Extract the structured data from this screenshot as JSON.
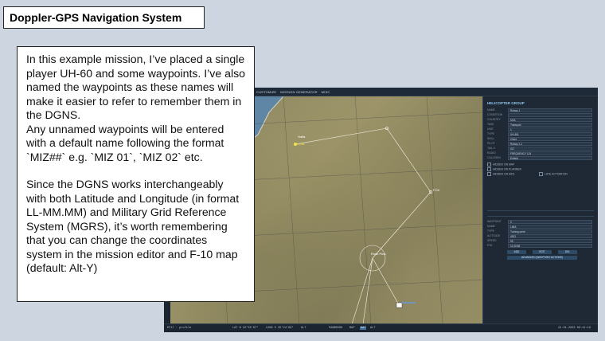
{
  "slide": {
    "title": "Doppler-GPS Navigation System",
    "body_paragraphs": [
      "In this example mission, I’ve placed a single player UH-60 and some waypoints. I’ve also named the waypoints as these names will make it easier to refer to remember them in the DGNS.",
      "Any unnamed waypoints will be entered with a default name following the format `MIZ##` e.g. `MIZ 01`, `MIZ 02` etc.",
      "Since the DGNS works interchangeably with both Latitude and Longitude (in format LL-MM.MM) and Military Grid Reference System (MGRS), it’s worth remembering that you can change the coordinates system in the mission editor and F-10 map (default: Alt-Y)"
    ]
  },
  "editor": {
    "menu": [
      "CUSTOMIZE",
      "MISSION GENERATOR",
      "MISC"
    ],
    "panel_title": "HELICOPTER GROUP",
    "fields": [
      {
        "label": "NAME",
        "value": "Rotary-1"
      },
      {
        "label": "CONDITION",
        "value": ""
      },
      {
        "label": "COUNTRY",
        "value": "USA"
      },
      {
        "label": "TASK",
        "value": "Transport"
      },
      {
        "label": "UNIT",
        "value": "1"
      },
      {
        "label": "TYPE",
        "value": "UH-60L"
      },
      {
        "label": "SKILL",
        "value": "Client"
      },
      {
        "label": "PILOT",
        "value": "Rotary-1-1"
      },
      {
        "label": "TAIL #",
        "value": "017"
      },
      {
        "label": "RADIO",
        "value": "FREQUENCY 124"
      },
      {
        "label": "CALLSIGN",
        "value": "Enfield"
      }
    ],
    "checkboxes": [
      "HIDDEN ON MAP",
      "HIDDEN ON PLANNER",
      "HIDDEN ON MFD",
      "LATE ACTIVATION"
    ],
    "waypoint_fields": [
      {
        "label": "WAYPOINT",
        "value": "0"
      },
      {
        "label": "NAME",
        "value": "LIMA"
      },
      {
        "label": "TYPE",
        "value": "Turning point"
      },
      {
        "label": "ALTITUDE",
        "value": "4922"
      },
      {
        "label": "SPEED",
        "value": "95"
      },
      {
        "label": "ETA",
        "value": "11:40:58"
      }
    ],
    "buttons": [
      "ADD",
      "EDIT",
      "DEL"
    ],
    "advanced_button": "ADVANCED (WAYPOINT ACTIONS)",
    "map_labels": [
      "Haifa",
      "LIMA",
      "FOX",
      "Rosh Pina",
      "Nazareth"
    ],
    "status_bar": {
      "left": "EF17 · profile",
      "lat": "LAT N 32°35'07\"",
      "long": "LONG E 35°24'09\"",
      "alt": "ALT",
      "mode_label": "PANBRUSH",
      "map_btn": "MAP",
      "sat_btn": "SAT",
      "alt_btn": "ALT",
      "date": "24.01.2023 09:41:18"
    }
  }
}
